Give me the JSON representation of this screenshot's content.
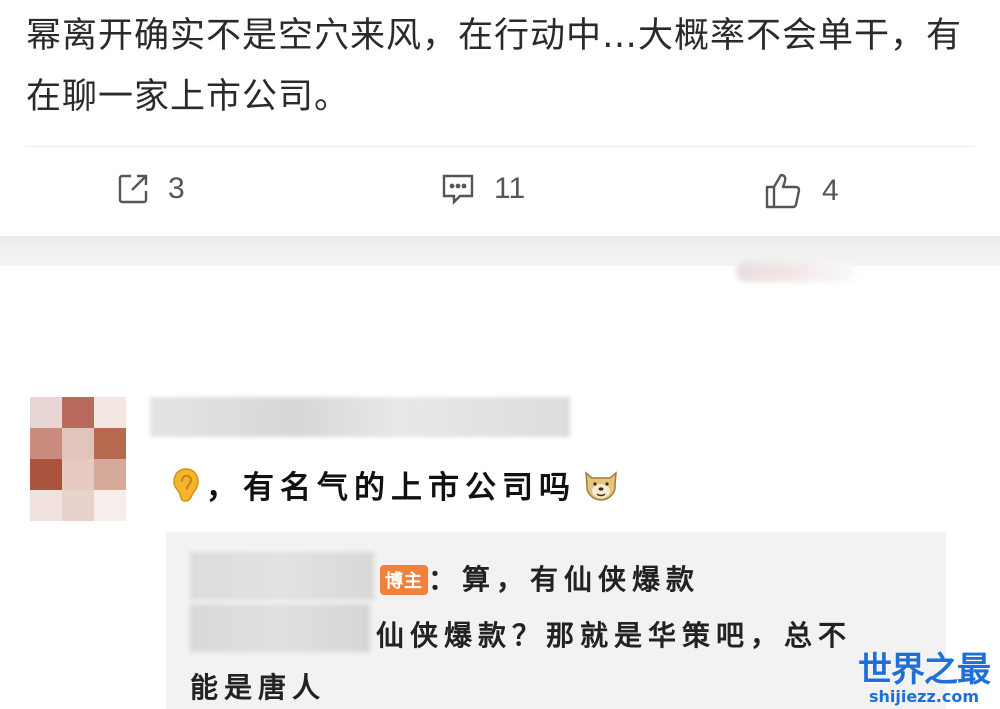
{
  "post": {
    "text": "幂离开确实不是空穴来风，在行动中…大概率不会单干，有在聊一家上市公司。"
  },
  "actions": {
    "share": {
      "icon": "share-icon",
      "count": "3"
    },
    "comment": {
      "icon": "comment-icon",
      "count": "11"
    },
    "like": {
      "icon": "thumbs-up-icon",
      "count": "4"
    }
  },
  "comment": {
    "text": "，有名气的上市公司吗",
    "leading_emoji": "ear-emoji-icon",
    "trailing_emoji": "doge-emoji-icon"
  },
  "reply": {
    "badge": "博主",
    "line1": "：算，有仙侠爆款",
    "line2": "仙侠爆款？那就是华策吧，总不",
    "line3": "能是唐人"
  },
  "watermark": {
    "title": "世界之最",
    "domain": "shijiezz.com"
  },
  "colors": {
    "badge": "#f0823c",
    "watermark": "#1e6fd9",
    "reply_background": "#f2f2f2"
  }
}
